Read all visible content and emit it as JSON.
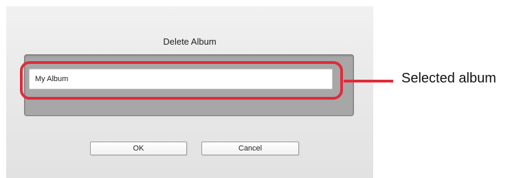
{
  "dialog": {
    "title": "Delete Album",
    "album_name": "My Album",
    "ok_label": "OK",
    "cancel_label": "Cancel"
  },
  "annotation": {
    "label": "Selected album",
    "color": "#e02b3a"
  }
}
